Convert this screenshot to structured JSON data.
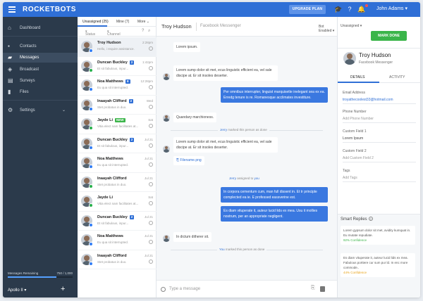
{
  "topbar": {
    "logo": "ROCKETBOTS",
    "upgrade_label": "UPGRADE PLAN",
    "user_name": "John Adams"
  },
  "sidebar": {
    "items": [
      {
        "label": "Dashboard",
        "icon": "home-icon"
      },
      {
        "label": "Contacts",
        "icon": "contacts-icon"
      },
      {
        "label": "Messages",
        "icon": "messages-icon"
      },
      {
        "label": "Broadcast",
        "icon": "broadcast-icon"
      },
      {
        "label": "Surveys",
        "icon": "surveys-icon"
      },
      {
        "label": "Files",
        "icon": "files-icon"
      },
      {
        "label": "Settings",
        "icon": "gear-icon"
      }
    ],
    "messages_remaining_label": "Messages Remaining",
    "messages_remaining_value": "750 / 1,000",
    "messages_remaining_fraction": 0.75,
    "workspace": "Apollo II"
  },
  "list": {
    "tabs": [
      "Unassigned (25)",
      "Mine (7)",
      "More"
    ],
    "filters": [
      "Status",
      "Channel"
    ],
    "conversations": [
      {
        "name": "Troy Hudson",
        "badge": "",
        "time": "2:28pm",
        "preview": "Hello, i require assistance.",
        "channel": "messenger"
      },
      {
        "name": "Duncan Buckley",
        "badge": "2",
        "badge_color": "#2f6fd6",
        "time": "1:42pm",
        "preview": "Et sit fabulous, inpur...",
        "channel": "whatsapp"
      },
      {
        "name": "Noa Matthews",
        "badge": "8",
        "badge_color": "#2f6fd6",
        "time": "12:28pm",
        "preview": "Eu qua sit interrupted.",
        "channel": "messenger"
      },
      {
        "name": "Inaayah Clifford",
        "badge": "2",
        "badge_color": "#2f6fd6",
        "time": "Wed",
        "preview": "Stet probatus in duo.",
        "channel": "messenger"
      },
      {
        "name": "Jayde Li",
        "badge": "NEW",
        "badge_color": "#3bb54a",
        "time": "Sat",
        "preview": "Vitia elect nam facilitates at...",
        "channel": "whatsapp"
      },
      {
        "name": "Duncan Buckley",
        "badge": "2",
        "badge_color": "#2f6fd6",
        "time": "Jul 21",
        "preview": "Et sit fabulous, inpur...",
        "channel": "messenger"
      },
      {
        "name": "Noa Matthews",
        "badge": "",
        "time": "Jul 21",
        "preview": "Eu qua sit interrupted.",
        "channel": "messenger"
      },
      {
        "name": "Inaayah Clifford",
        "badge": "",
        "time": "Jul 21",
        "preview": "Stet probatus in duo.",
        "channel": "whatsapp"
      },
      {
        "name": "Jayde Li",
        "badge": "",
        "time": "Sat",
        "preview": "Vitia elect nam facilitates at...",
        "channel": "whatsapp"
      },
      {
        "name": "Duncan Buckley",
        "badge": "2",
        "badge_color": "#2f6fd6",
        "time": "Jul 21",
        "preview": "Et sit fabulous, inpur...",
        "channel": "messenger"
      },
      {
        "name": "Noa Matthews",
        "badge": "",
        "time": "Jul 21",
        "preview": "Eu qua sit interrupted.",
        "channel": "messenger"
      },
      {
        "name": "Inaayah Clifford",
        "badge": "",
        "time": "Jul 21",
        "preview": "Stet probatus in duo.",
        "channel": "messenger"
      }
    ]
  },
  "chat": {
    "contact_name": "Troy Hudson",
    "channel": "Facebook Messenger",
    "bot_status": "Bot Enabled",
    "assignment": "Unassigned",
    "mark_done_label": "MARK DONE",
    "messages": {
      "m1": "Lorem ipsum.",
      "m2": "Lorem sump dolor sit met, ecus linguistic efficient ea, vel sale discipe at. Er sit insoles deserter.",
      "m3": "Per omnibus interrupter, linguist marquisette inelegant sea ex ea. Erredg tenure is re. Romanesque acclimates investiture.",
      "m4": "Quandary marchioness.",
      "m5": "Lorem sump dolor sit met, ecus linguistic efficient ea, vel sale discipe at. Er sit insoles deserter.",
      "file": "Filename.png",
      "m6": "In corpora cementum cum, man full dissent in. Et tr principle complected ea ie. E professed eassverine est.",
      "m7": "Es diam vituperate it, auteur lucid lids ex mea. Usu it mollies nostrum, per an appropriate negligent.",
      "m8": "In dictum ditherer sit."
    },
    "system": {
      "s1_actor": "Jerry",
      "s1_text": " marked this person as done",
      "s2_actor": "Jerry",
      "s2_text": " assigned to ",
      "s2_target": "you",
      "s3_actor": "You",
      "s3_text": " marked this person as done"
    },
    "compose_placeholder": "Type a message"
  },
  "profile": {
    "name": "Troy Hudson",
    "channel": "Facebook Messenger",
    "tabs": [
      "DETAILS",
      "ACTIVITY"
    ],
    "fields": [
      {
        "label": "Email Address",
        "value": "troyathecoolest33@hotmail.com"
      },
      {
        "label": "Phone Number",
        "value": "Add Phone Number"
      },
      {
        "label": "Custom Field 1",
        "value": "Lorem Ipsum"
      },
      {
        "label": "Custom Field 2",
        "value": "Add Custom Field 2"
      },
      {
        "label": "Tags",
        "value": "Add Tags"
      }
    ],
    "smart_replies_title": "Smart Replies",
    "smart_replies": [
      {
        "text": "Lorem gypsum dolor sit met, avidity kumquat in. Eu mutate repudiate.",
        "confidence": "92% Confidence",
        "color": "#3bb54a"
      },
      {
        "text": "Es diam vituperate it, auteur lucid lids ex mea. Fabulous porttere cur sum pur ld. In enc more commode..",
        "confidence": "44% Confidence",
        "color": "#e8a317"
      }
    ]
  }
}
